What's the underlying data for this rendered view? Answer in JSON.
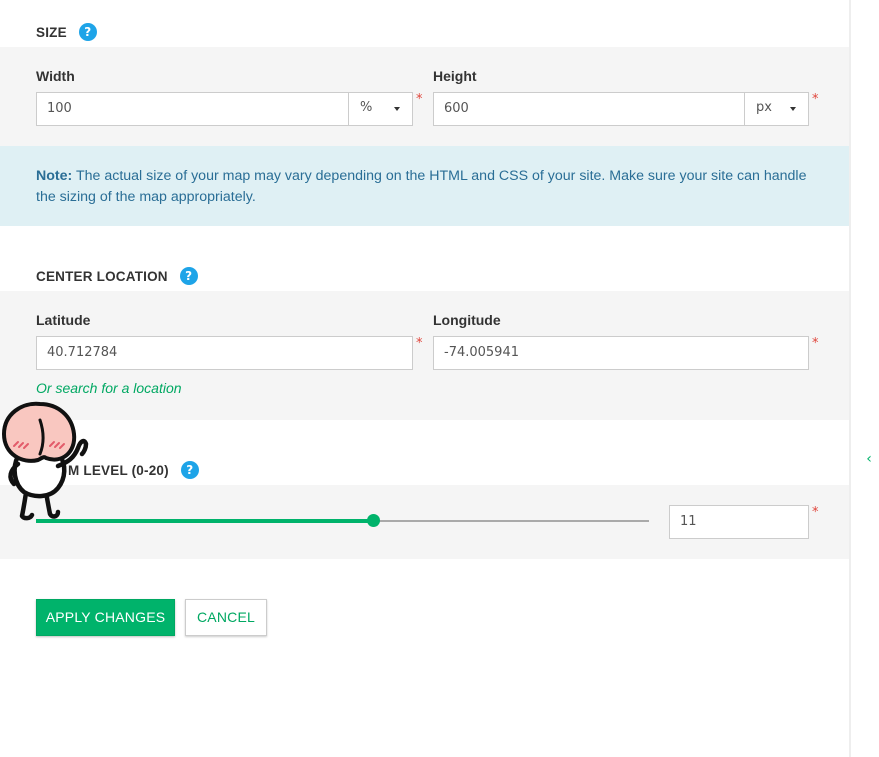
{
  "size": {
    "heading": "SIZE",
    "width": {
      "label": "Width",
      "value": "100",
      "unit": "%"
    },
    "height": {
      "label": "Height",
      "value": "600",
      "unit": "px"
    }
  },
  "note": {
    "prefix": "Note:",
    "text": " The actual size of your map may vary depending on the HTML and CSS of your site. Make sure your site can handle the sizing of the map appropriately."
  },
  "center": {
    "heading": "CENTER LOCATION",
    "latitude": {
      "label": "Latitude",
      "value": "40.712784"
    },
    "longitude": {
      "label": "Longitude",
      "value": "-74.005941"
    },
    "search_link": "Or search for a location"
  },
  "zoom": {
    "heading_visible": "M LEVEL (0-20)",
    "value": "11",
    "min": 0,
    "max": 20,
    "slider_fraction": 0.55
  },
  "buttons": {
    "apply": "APPLY CHANGES",
    "cancel": "CANCEL"
  },
  "icons": {
    "help": "?",
    "required": "*",
    "collapse": "‹"
  },
  "colors": {
    "accent_green": "#00b36b",
    "help_blue": "#1ea4e8",
    "note_bg": "#dff0f4",
    "note_text": "#2a6e96",
    "required_red": "#e0443a"
  }
}
